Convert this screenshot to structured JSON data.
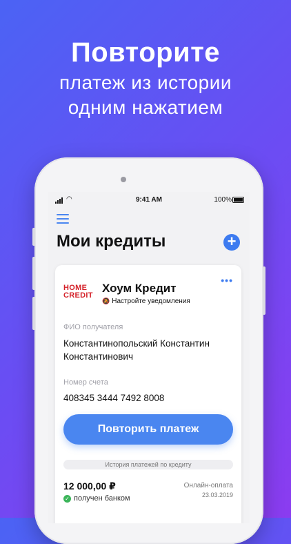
{
  "promo": {
    "headline": "Повторите",
    "subline_1": "платеж из истории",
    "subline_2": "одним нажатием"
  },
  "status_bar": {
    "time": "9:41 AM",
    "battery": "100%"
  },
  "header": {
    "title": "Мои кредиты"
  },
  "card": {
    "logo_line_1": "HOME",
    "logo_line_2": "CREDIT",
    "bank_name": "Хоум Кредит",
    "notification_setup": "Настройте уведомления",
    "recipient_label": "ФИО получателя",
    "recipient_line_1": "Константинопольский Константин",
    "recipient_line_2": "Константинович",
    "account_label": "Номер счета",
    "account_number": "408345 3444 7492 8008",
    "repeat_button": "Повторить платеж",
    "history_label": "История платежей по кредиту",
    "payment": {
      "amount": "12 000,00 ₽",
      "status": "получен банком",
      "method": "Онлайн-оплата",
      "date": "23.03.2019"
    }
  },
  "colors": {
    "accent": "#4a86f0",
    "brand_red": "#d42028",
    "success": "#3cb55a"
  }
}
